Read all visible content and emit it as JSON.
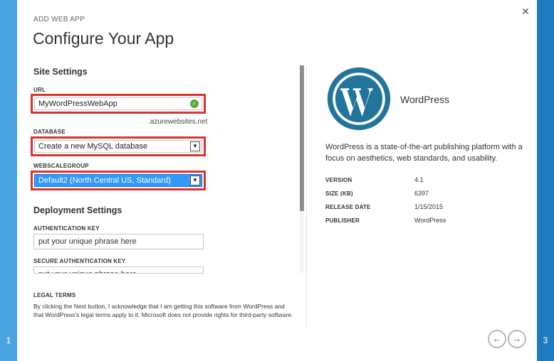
{
  "wizard": {
    "label": "ADD WEB APP",
    "title": "Configure Your App",
    "step_left": "1",
    "step_right": "3",
    "close_glyph": "✕"
  },
  "site_settings": {
    "title": "Site Settings",
    "url_label": "URL",
    "url_value": "MyWordPressWebApp",
    "url_suffix": ".azurewebsites.net",
    "database_label": "DATABASE",
    "database_value": "Create a new MySQL database",
    "webscalegroup_label": "WEBSCALEGROUP",
    "webscalegroup_value": "Default2 (North Central US, Standard)"
  },
  "deployment_settings": {
    "title": "Deployment Settings",
    "auth_key_label": "AUTHENTICATION KEY",
    "auth_key_value": "put your unique phrase here",
    "secure_auth_key_label": "SECURE AUTHENTICATION KEY",
    "secure_auth_key_value": "put your unique phrase here"
  },
  "legal": {
    "title": "LEGAL TERMS",
    "text_line1": "By clicking the Next button, I acknowledge that I am getting this software from WordPress and",
    "text_line2": "that WordPress's legal terms apply to it. Microsoft does not provide rights for third-party software."
  },
  "app_info": {
    "name": "WordPress",
    "description": "WordPress is a state-of-the-art publishing platform with a focus on aesthetics, web standards, and usability.",
    "version_label": "VERSION",
    "version_value": "4.1",
    "size_label": "SIZE (KB)",
    "size_value": "6397",
    "release_label": "RELEASE DATE",
    "release_value": "1/15/2015",
    "publisher_label": "PUBLISHER",
    "publisher_value": "WordPress"
  },
  "nav": {
    "back_glyph": "←",
    "next_glyph": "→"
  },
  "icons": {
    "check": "✓",
    "dropdown": "▼"
  },
  "colors": {
    "accent_left": "#4aa3df",
    "accent_right": "#1f7bbf",
    "highlight_frame": "#d9332e",
    "selection": "#3399ff",
    "valid": "#5aa83a",
    "wordpress_blue": "#21759b"
  }
}
